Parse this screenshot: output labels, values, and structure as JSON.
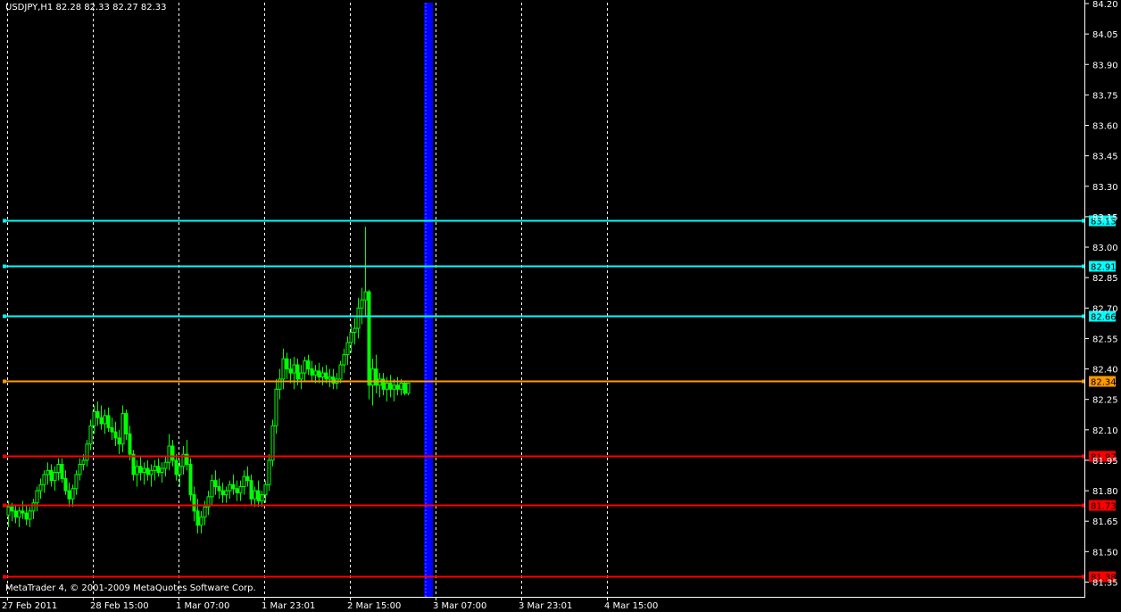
{
  "window": {
    "symbol_info": "USDJPY,H1  82.28 82.33 82.27 82.33",
    "copyright": "MetaTrader 4, © 2001-2009 MetaQuotes Software Corp."
  },
  "colors": {
    "background": "#000000",
    "foreground": "#ffffff",
    "candle": "#00ff00",
    "support_line": "#ff0000",
    "resistance_line": "#00ffff",
    "current_price_line": "#ff9900",
    "highlight_band": "#0000ff"
  },
  "chart_data": {
    "type": "candlestick",
    "instrument": "USDJPY",
    "timeframe": "H1",
    "ylim": [
      81.33,
      84.2
    ],
    "y_ticks": [
      "84.20",
      "84.05",
      "83.90",
      "83.75",
      "83.60",
      "83.45",
      "83.30",
      "83.15",
      "83.00",
      "82.85",
      "82.70",
      "82.55",
      "82.40",
      "82.25",
      "82.10",
      "81.95",
      "81.80",
      "81.65",
      "81.50",
      "81.35"
    ],
    "x_ticks": [
      "27 Feb 2011",
      "28 Feb 15:00",
      "1 Mar 07:00",
      "1 Mar 23:01",
      "2 Mar 15:00",
      "3 Mar 07:00",
      "3 Mar 23:01",
      "4 Mar 15:00"
    ],
    "grid": "vertical dashed",
    "bar_count": 120,
    "ohlc": [
      [
        81.68,
        81.75,
        81.62,
        81.72
      ],
      [
        81.72,
        81.74,
        81.65,
        81.7
      ],
      [
        81.7,
        81.73,
        81.64,
        81.67
      ],
      [
        81.67,
        81.72,
        81.62,
        81.7
      ],
      [
        81.7,
        81.75,
        81.66,
        81.69
      ],
      [
        81.69,
        81.73,
        81.63,
        81.66
      ],
      [
        81.66,
        81.72,
        81.62,
        81.7
      ],
      [
        81.7,
        81.76,
        81.66,
        81.74
      ],
      [
        81.74,
        81.82,
        81.7,
        81.8
      ],
      [
        81.8,
        81.86,
        81.76,
        81.83
      ],
      [
        81.83,
        81.9,
        81.79,
        81.88
      ],
      [
        81.88,
        81.94,
        81.83,
        81.9
      ],
      [
        81.9,
        81.93,
        81.82,
        81.85
      ],
      [
        81.85,
        81.92,
        81.8,
        81.89
      ],
      [
        81.89,
        81.96,
        81.85,
        81.93
      ],
      [
        81.93,
        81.96,
        81.84,
        81.86
      ],
      [
        81.86,
        81.9,
        81.78,
        81.8
      ],
      [
        81.8,
        81.84,
        81.72,
        81.76
      ],
      [
        81.76,
        81.83,
        81.72,
        81.81
      ],
      [
        81.81,
        81.9,
        81.78,
        81.88
      ],
      [
        81.88,
        81.96,
        81.85,
        81.93
      ],
      [
        81.93,
        81.98,
        81.9,
        81.95
      ],
      [
        81.95,
        82.05,
        81.92,
        82.03
      ],
      [
        82.03,
        82.15,
        82.0,
        82.12
      ],
      [
        82.12,
        82.22,
        82.08,
        82.19
      ],
      [
        82.19,
        82.24,
        82.12,
        82.16
      ],
      [
        82.16,
        82.22,
        82.1,
        82.13
      ],
      [
        82.13,
        82.2,
        82.08,
        82.17
      ],
      [
        82.17,
        82.21,
        82.09,
        82.11
      ],
      [
        82.11,
        82.16,
        82.05,
        82.09
      ],
      [
        82.09,
        82.14,
        82.02,
        82.06
      ],
      [
        82.06,
        82.1,
        81.98,
        82.03
      ],
      [
        82.03,
        82.22,
        81.99,
        82.18
      ],
      [
        82.18,
        82.2,
        82.05,
        82.08
      ],
      [
        82.08,
        82.12,
        81.95,
        81.98
      ],
      [
        81.98,
        82.0,
        81.85,
        81.88
      ],
      [
        81.88,
        81.95,
        81.82,
        81.92
      ],
      [
        81.92,
        81.97,
        81.85,
        81.89
      ],
      [
        81.89,
        81.94,
        81.83,
        81.91
      ],
      [
        81.91,
        81.95,
        81.85,
        81.88
      ],
      [
        81.88,
        81.93,
        81.82,
        81.9
      ],
      [
        81.9,
        81.95,
        81.85,
        81.92
      ],
      [
        81.92,
        81.96,
        81.87,
        81.89
      ],
      [
        81.89,
        81.94,
        81.84,
        81.91
      ],
      [
        81.91,
        81.97,
        81.87,
        81.94
      ],
      [
        81.94,
        82.08,
        81.9,
        82.02
      ],
      [
        82.02,
        82.05,
        81.92,
        81.95
      ],
      [
        81.95,
        81.98,
        81.85,
        81.88
      ],
      [
        81.88,
        81.95,
        81.82,
        81.92
      ],
      [
        81.92,
        82.02,
        81.88,
        81.98
      ],
      [
        81.98,
        82.05,
        81.9,
        81.93
      ],
      [
        81.93,
        81.96,
        81.75,
        81.78
      ],
      [
        81.78,
        81.82,
        81.65,
        81.7
      ],
      [
        81.7,
        81.76,
        81.59,
        81.63
      ],
      [
        81.63,
        81.7,
        81.59,
        81.67
      ],
      [
        81.67,
        81.75,
        81.63,
        81.72
      ],
      [
        81.72,
        81.8,
        81.68,
        81.77
      ],
      [
        81.77,
        81.88,
        81.73,
        81.85
      ],
      [
        81.85,
        81.9,
        81.78,
        81.82
      ],
      [
        81.82,
        81.86,
        81.76,
        81.8
      ],
      [
        81.8,
        81.84,
        81.74,
        81.78
      ],
      [
        81.78,
        81.82,
        81.74,
        81.8
      ],
      [
        81.8,
        81.85,
        81.76,
        81.83
      ],
      [
        81.83,
        81.88,
        81.78,
        81.81
      ],
      [
        81.81,
        81.85,
        81.75,
        81.79
      ],
      [
        81.79,
        81.85,
        81.75,
        81.82
      ],
      [
        81.82,
        81.9,
        81.78,
        81.87
      ],
      [
        81.87,
        81.92,
        81.82,
        81.85
      ],
      [
        81.85,
        81.88,
        81.73,
        81.76
      ],
      [
        81.76,
        81.82,
        81.72,
        81.8
      ],
      [
        81.8,
        81.85,
        81.72,
        81.75
      ],
      [
        81.75,
        81.8,
        81.72,
        81.78
      ],
      [
        81.78,
        81.85,
        81.74,
        81.83
      ],
      [
        81.83,
        81.98,
        81.8,
        81.95
      ],
      [
        81.95,
        82.15,
        81.92,
        82.12
      ],
      [
        82.12,
        82.35,
        82.08,
        82.3
      ],
      [
        82.3,
        82.4,
        82.25,
        82.35
      ],
      [
        82.35,
        82.5,
        82.3,
        82.45
      ],
      [
        82.45,
        82.48,
        82.35,
        82.4
      ],
      [
        82.4,
        82.45,
        82.33,
        82.38
      ],
      [
        82.38,
        82.46,
        82.3,
        82.42
      ],
      [
        82.42,
        82.45,
        82.32,
        82.35
      ],
      [
        82.35,
        82.42,
        82.3,
        82.38
      ],
      [
        82.38,
        82.46,
        82.34,
        82.44
      ],
      [
        82.44,
        82.47,
        82.37,
        82.4
      ],
      [
        82.4,
        82.44,
        82.34,
        82.37
      ],
      [
        82.37,
        82.42,
        82.33,
        82.39
      ],
      [
        82.39,
        82.43,
        82.33,
        82.36
      ],
      [
        82.36,
        82.41,
        82.32,
        82.38
      ],
      [
        82.38,
        82.42,
        82.33,
        82.35
      ],
      [
        82.35,
        82.4,
        82.31,
        82.36
      ],
      [
        82.36,
        82.4,
        82.3,
        82.33
      ],
      [
        82.33,
        82.38,
        82.3,
        82.35
      ],
      [
        82.35,
        82.44,
        82.33,
        82.42
      ],
      [
        82.42,
        82.5,
        82.38,
        82.47
      ],
      [
        82.47,
        82.56,
        82.42,
        82.53
      ],
      [
        82.53,
        82.62,
        82.48,
        82.58
      ],
      [
        82.58,
        82.65,
        82.52,
        82.6
      ],
      [
        82.6,
        82.75,
        82.55,
        82.7
      ],
      [
        82.7,
        82.8,
        82.62,
        82.74
      ],
      [
        82.74,
        83.1,
        82.66,
        82.78
      ],
      [
        82.78,
        82.79,
        82.25,
        82.32
      ],
      [
        82.32,
        82.45,
        82.22,
        82.4
      ],
      [
        82.4,
        82.47,
        82.28,
        82.32
      ],
      [
        82.32,
        82.38,
        82.26,
        82.35
      ],
      [
        82.35,
        82.38,
        82.27,
        82.3
      ],
      [
        82.3,
        82.36,
        82.24,
        82.33
      ],
      [
        82.33,
        82.37,
        82.26,
        82.3
      ],
      [
        82.3,
        82.35,
        82.24,
        82.32
      ],
      [
        82.32,
        82.36,
        82.27,
        82.3
      ],
      [
        82.3,
        82.35,
        82.27,
        82.33
      ],
      [
        82.33,
        82.34,
        82.27,
        82.28
      ],
      [
        82.28,
        82.33,
        82.27,
        82.33
      ]
    ],
    "horizontal_lines": [
      {
        "price": 83.13,
        "label": "83.13",
        "role": "resistance"
      },
      {
        "price": 82.91,
        "label": "82.91",
        "role": "resistance"
      },
      {
        "price": 82.66,
        "label": "82.66",
        "role": "resistance"
      },
      {
        "price": 82.34,
        "label": "82.34",
        "role": "current"
      },
      {
        "price": 81.97,
        "label": "81.97",
        "role": "support"
      },
      {
        "price": 81.73,
        "label": "81.73",
        "role": "support"
      },
      {
        "price": 81.38,
        "label": "81.38",
        "role": "support"
      }
    ]
  }
}
